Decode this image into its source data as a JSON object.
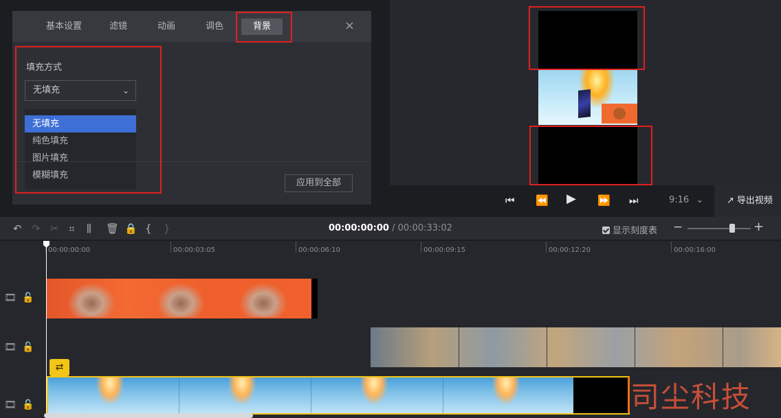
{
  "settings": {
    "tabs": [
      {
        "label": "基本设置"
      },
      {
        "label": "滤镜"
      },
      {
        "label": "动画"
      },
      {
        "label": "调色"
      },
      {
        "label": "背景",
        "active": true
      }
    ],
    "close_glyph": "×",
    "fill_mode_label": "填充方式",
    "fill_mode_value": "无填充",
    "fill_options": [
      "无填充",
      "纯色填充",
      "图片填充",
      "模糊填充"
    ],
    "apply_all_label": "应用到全部"
  },
  "playback": {
    "ratio": "9:16",
    "export_label": "导出视频"
  },
  "toolbar": {
    "current_time": "00:00:00:00",
    "separator": " / ",
    "total_time": "00:00:33:02",
    "show_scale_label": "显示刻度表"
  },
  "ruler": {
    "labels": [
      "00:00:00:00",
      "00:00:03:05",
      "00:00:06:10",
      "00:00:09:15",
      "00:00:12:20",
      "00:00:16:00"
    ]
  },
  "watermark": "司尘科技",
  "colors": {
    "accent_blue": "#3d6fd6",
    "annotation_red": "#e02020",
    "clip_selected_yellow": "#f2c516"
  },
  "icons": {
    "undo": "undo-icon",
    "redo": "redo-icon",
    "cut": "scissors-icon",
    "crop": "crop-icon",
    "split": "split-icon",
    "delete": "trash-icon",
    "lock": "lock-icon",
    "track_video": "film-icon",
    "loop": "loop-icon"
  }
}
